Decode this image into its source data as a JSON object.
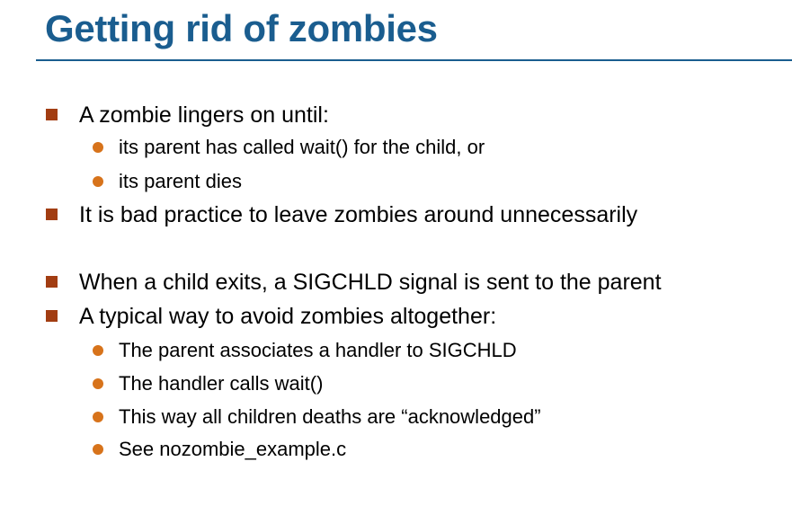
{
  "slide": {
    "title": "Getting rid of zombies",
    "bullets": [
      {
        "text": "A zombie lingers on until:",
        "sub": [
          "its parent has called wait() for the child, or",
          "its parent dies"
        ]
      },
      {
        "text": "It is bad practice to leave zombies around unnecessarily",
        "sub": []
      },
      {
        "text": "When a child exits, a SIGCHLD signal is sent to the parent",
        "sub": []
      },
      {
        "text": "A typical way to avoid zombies altogether:",
        "sub": [
          "The parent associates a handler to SIGCHLD",
          "The handler calls wait()",
          "This way all children deaths are “acknowledged”",
          "See nozombie_example.c"
        ]
      }
    ]
  },
  "colors": {
    "title": "#1a5d8f",
    "rule": "#1a5d8f",
    "bullet_square": "#a23d12",
    "bullet_dot": "#d7731b"
  }
}
